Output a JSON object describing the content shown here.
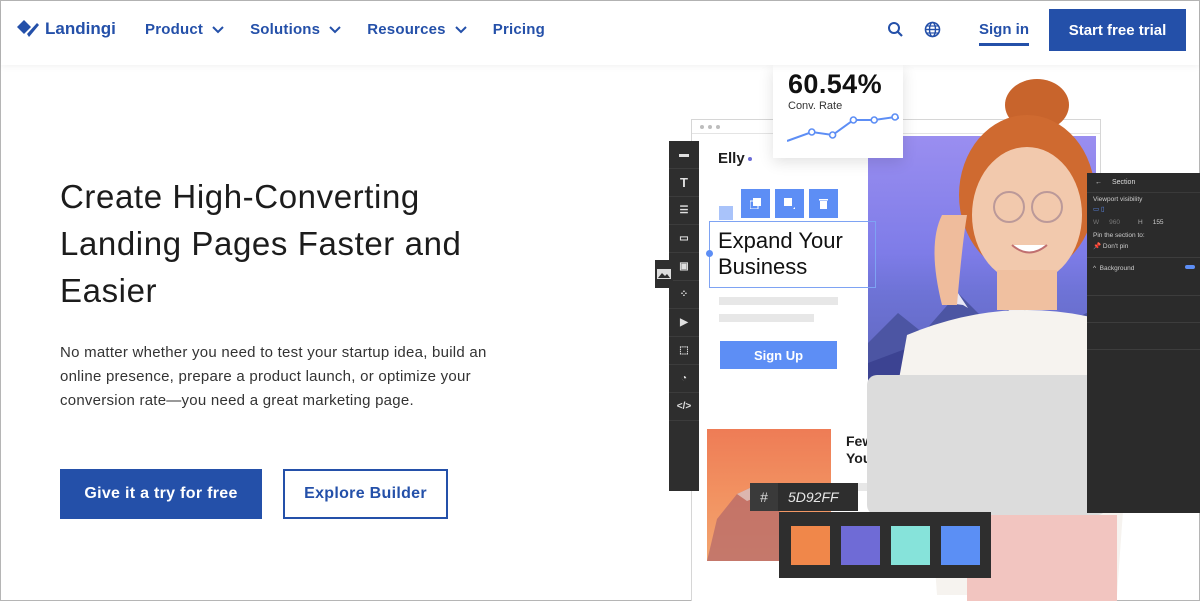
{
  "nav": {
    "brand": "Landingi",
    "menu": [
      {
        "label": "Product",
        "has_dropdown": true
      },
      {
        "label": "Solutions",
        "has_dropdown": true
      },
      {
        "label": "Resources",
        "has_dropdown": true
      },
      {
        "label": "Pricing",
        "has_dropdown": false
      }
    ],
    "icons": [
      "search-icon",
      "globe-icon"
    ],
    "sign_in": "Sign in",
    "cta": "Start free trial"
  },
  "hero": {
    "title": "Create High-Converting Landing Pages Faster and Easier",
    "description": "No matter whether you need to test your startup idea, build an online presence, prepare a product launch, or optimize your conversion rate—you need a great marketing page.",
    "primary_button": "Give it a try for free",
    "secondary_button": "Explore Builder"
  },
  "illustration": {
    "conv_rate_value": "60.54%",
    "conv_rate_label": "Conv. Rate",
    "conv_rate_trend": [
      2,
      5,
      4,
      9,
      9,
      10
    ],
    "brand_name": "Elly",
    "headline": "Expand Your Business",
    "signup_label": "Sign Up",
    "secondary_headline": "Few You",
    "hex_symbol": "#",
    "hex_value": "5D92FF",
    "swatches": [
      "#f0874a",
      "#6f6bd6",
      "#86e3da",
      "#5b8ff5"
    ],
    "accent_color": "#2450a9",
    "toolbar_tools": [
      "section-icon",
      "text-icon",
      "row-icon",
      "button-icon",
      "image-icon",
      "widgets-icon",
      "video-icon",
      "box-icon",
      "timer-icon",
      "code-icon"
    ],
    "panel": {
      "title": "Section",
      "viewport_label": "Viewport visibility",
      "width_label": "W",
      "width_value": "960",
      "height_label": "H",
      "height_value": "155",
      "pin_label": "Pin the section to:",
      "pin_value": "Don't pin",
      "background_label": "Background"
    }
  }
}
